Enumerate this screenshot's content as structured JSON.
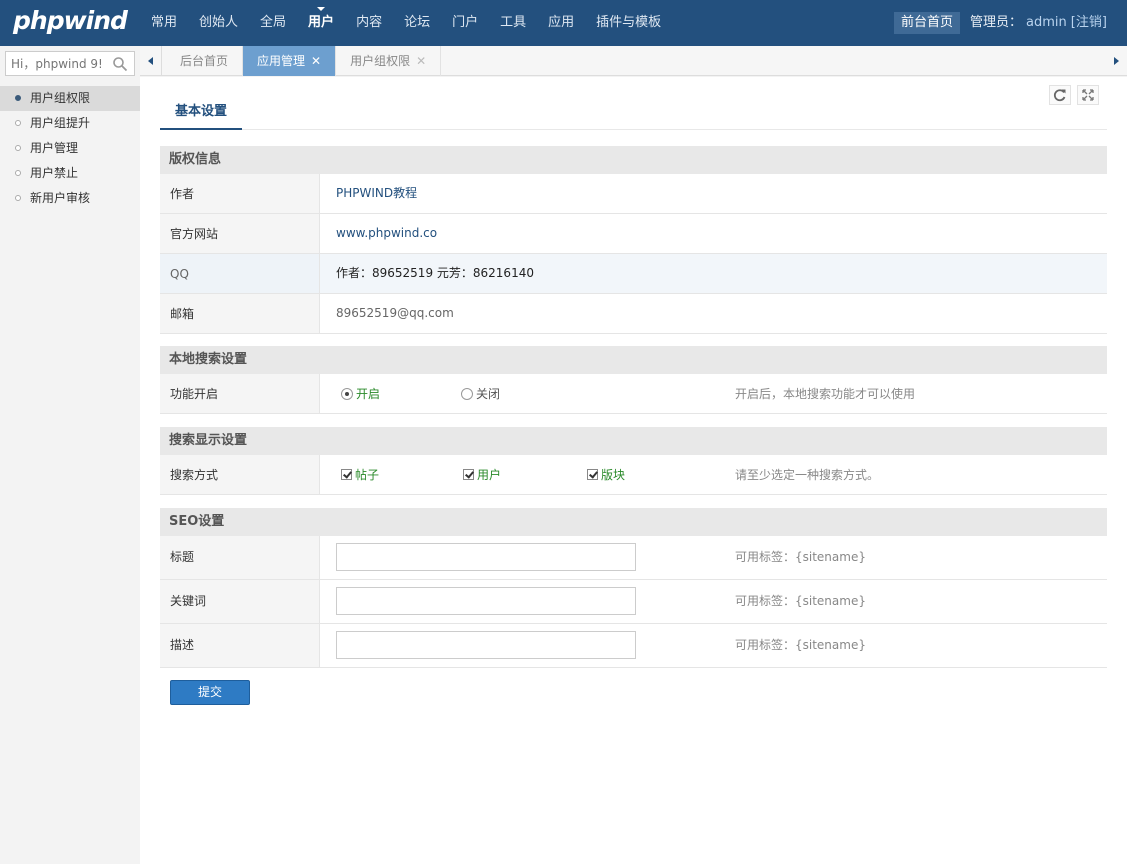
{
  "header": {
    "logo": "phpwind",
    "nav": [
      "常用",
      "创始人",
      "全局",
      "用户",
      "内容",
      "论坛",
      "门户",
      "工具",
      "应用",
      "插件与模板"
    ],
    "nav_active": 3,
    "front_link": "前台首页",
    "admin_label": "管理员：",
    "admin_name": "admin",
    "logout": "[注销]"
  },
  "sidebar": {
    "search_placeholder": "Hi，phpwind 9!",
    "items": [
      {
        "label": "用户组权限",
        "active": true
      },
      {
        "label": "用户组提升",
        "active": false
      },
      {
        "label": "用户管理",
        "active": false
      },
      {
        "label": "用户禁止",
        "active": false
      },
      {
        "label": "新用户审核",
        "active": false
      }
    ]
  },
  "tabs": [
    {
      "label": "后台首页",
      "active": false,
      "closable": false
    },
    {
      "label": "应用管理",
      "active": true,
      "closable": true
    },
    {
      "label": "用户组权限",
      "active": false,
      "closable": true
    }
  ],
  "subnav": {
    "active_tab": "基本设置"
  },
  "copyright": {
    "title": "版权信息",
    "author_label": "作者",
    "author_value": "PHPWIND教程",
    "site_label": "官方网站",
    "site_value": "www.phpwind.co",
    "qq_label": "QQ",
    "qq_value": "作者：89652519 元芳：86216140",
    "email_label": "邮箱",
    "email_value": "89652519@qq.com"
  },
  "local_search": {
    "title": "本地搜索设置",
    "label": "功能开启",
    "option_on": "开启",
    "option_off": "关闭",
    "selected": "开启",
    "tip": "开启后，本地搜索功能才可以使用"
  },
  "search_display": {
    "title": "搜索显示设置",
    "label": "搜索方式",
    "options": [
      "帖子",
      "用户",
      "版块"
    ],
    "tip": "请至少选定一种搜索方式。"
  },
  "seo": {
    "title": "SEO设置",
    "fields": [
      {
        "label": "标题",
        "value": "",
        "tip": "可用标签：{sitename}"
      },
      {
        "label": "关键词",
        "value": "",
        "tip": "可用标签：{sitename}"
      },
      {
        "label": "描述",
        "value": "",
        "tip": "可用标签：{sitename}"
      }
    ]
  },
  "submit_label": "提交",
  "colors": {
    "header_bg": "#23507e",
    "accent": "#2e7bc4",
    "active_tab": "#6d9fcf",
    "option_green": "#2a8a2a"
  }
}
